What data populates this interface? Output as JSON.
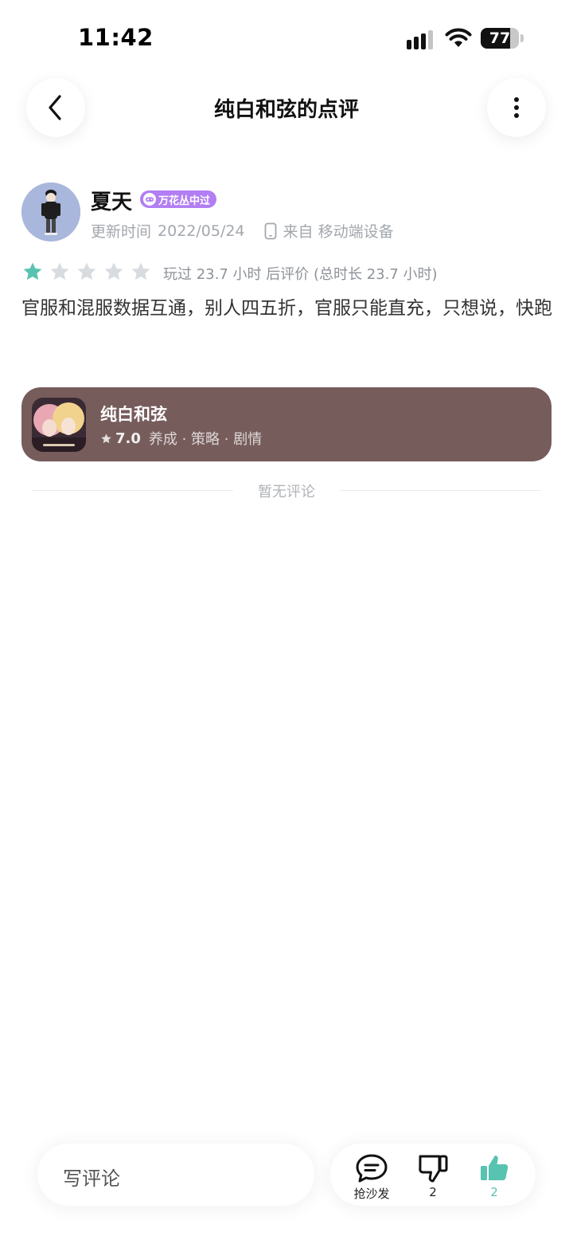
{
  "status_bar": {
    "time": "11:42",
    "battery": "77",
    "battery_level": 0.77,
    "icons": [
      "signal-icon",
      "wifi-icon",
      "battery-icon"
    ]
  },
  "nav": {
    "title": "纯白和弦的点评",
    "back_icon": "chevron-left-icon",
    "more_icon": "more-vertical-icon"
  },
  "author": {
    "name": "夏天",
    "badge": "万花丛中过",
    "update_label": "更新时间",
    "update_date": "2022/05/24",
    "device_text": "来自 移动端设备"
  },
  "rating": {
    "stars": 1,
    "max_stars": 5,
    "note": "玩过 23.7 小时 后评价 (总时长 23.7 小时)"
  },
  "review": {
    "text": "官服和混服数据互通，别人四五折，官服只能直充，只想说，快跑"
  },
  "game": {
    "name": "纯白和弦",
    "score": "7.0",
    "tags": "养成 · 策略 · 剧情"
  },
  "comments": {
    "empty_text": "暂无评论"
  },
  "bottom_bar": {
    "input_placeholder": "写评论",
    "sofa_label": "抢沙发",
    "dislike_count": "2",
    "like_count": "2"
  },
  "colors": {
    "accent": "#57c3b0",
    "badge": "#b27ef3",
    "card": "#775c5c",
    "star_off": "#d8dbe0"
  }
}
